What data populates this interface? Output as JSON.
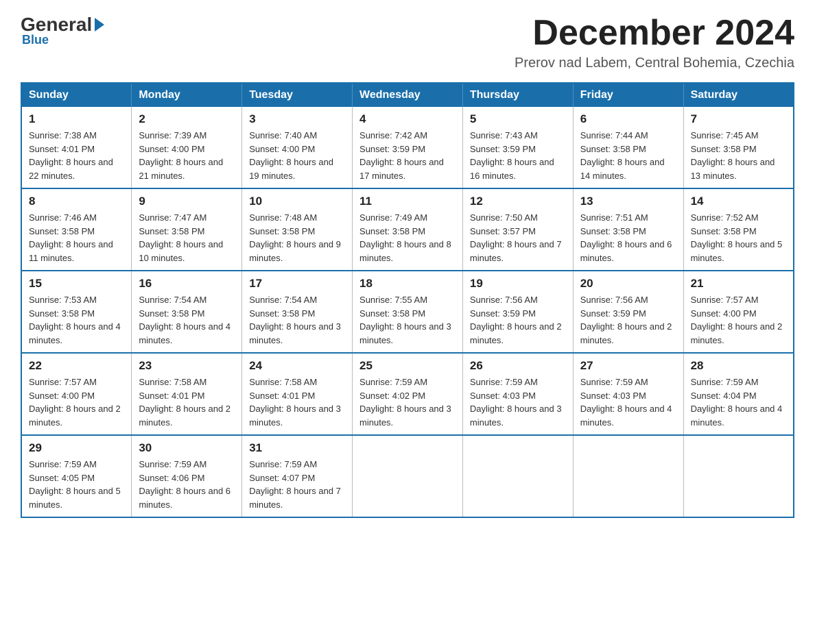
{
  "header": {
    "logo": {
      "general": "General",
      "blue": "Blue"
    },
    "title": "December 2024",
    "location": "Prerov nad Labem, Central Bohemia, Czechia"
  },
  "weekdays": [
    "Sunday",
    "Monday",
    "Tuesday",
    "Wednesday",
    "Thursday",
    "Friday",
    "Saturday"
  ],
  "weeks": [
    [
      {
        "day": "1",
        "sunrise": "7:38 AM",
        "sunset": "4:01 PM",
        "daylight": "8 hours and 22 minutes."
      },
      {
        "day": "2",
        "sunrise": "7:39 AM",
        "sunset": "4:00 PM",
        "daylight": "8 hours and 21 minutes."
      },
      {
        "day": "3",
        "sunrise": "7:40 AM",
        "sunset": "4:00 PM",
        "daylight": "8 hours and 19 minutes."
      },
      {
        "day": "4",
        "sunrise": "7:42 AM",
        "sunset": "3:59 PM",
        "daylight": "8 hours and 17 minutes."
      },
      {
        "day": "5",
        "sunrise": "7:43 AM",
        "sunset": "3:59 PM",
        "daylight": "8 hours and 16 minutes."
      },
      {
        "day": "6",
        "sunrise": "7:44 AM",
        "sunset": "3:58 PM",
        "daylight": "8 hours and 14 minutes."
      },
      {
        "day": "7",
        "sunrise": "7:45 AM",
        "sunset": "3:58 PM",
        "daylight": "8 hours and 13 minutes."
      }
    ],
    [
      {
        "day": "8",
        "sunrise": "7:46 AM",
        "sunset": "3:58 PM",
        "daylight": "8 hours and 11 minutes."
      },
      {
        "day": "9",
        "sunrise": "7:47 AM",
        "sunset": "3:58 PM",
        "daylight": "8 hours and 10 minutes."
      },
      {
        "day": "10",
        "sunrise": "7:48 AM",
        "sunset": "3:58 PM",
        "daylight": "8 hours and 9 minutes."
      },
      {
        "day": "11",
        "sunrise": "7:49 AM",
        "sunset": "3:58 PM",
        "daylight": "8 hours and 8 minutes."
      },
      {
        "day": "12",
        "sunrise": "7:50 AM",
        "sunset": "3:57 PM",
        "daylight": "8 hours and 7 minutes."
      },
      {
        "day": "13",
        "sunrise": "7:51 AM",
        "sunset": "3:58 PM",
        "daylight": "8 hours and 6 minutes."
      },
      {
        "day": "14",
        "sunrise": "7:52 AM",
        "sunset": "3:58 PM",
        "daylight": "8 hours and 5 minutes."
      }
    ],
    [
      {
        "day": "15",
        "sunrise": "7:53 AM",
        "sunset": "3:58 PM",
        "daylight": "8 hours and 4 minutes."
      },
      {
        "day": "16",
        "sunrise": "7:54 AM",
        "sunset": "3:58 PM",
        "daylight": "8 hours and 4 minutes."
      },
      {
        "day": "17",
        "sunrise": "7:54 AM",
        "sunset": "3:58 PM",
        "daylight": "8 hours and 3 minutes."
      },
      {
        "day": "18",
        "sunrise": "7:55 AM",
        "sunset": "3:58 PM",
        "daylight": "8 hours and 3 minutes."
      },
      {
        "day": "19",
        "sunrise": "7:56 AM",
        "sunset": "3:59 PM",
        "daylight": "8 hours and 2 minutes."
      },
      {
        "day": "20",
        "sunrise": "7:56 AM",
        "sunset": "3:59 PM",
        "daylight": "8 hours and 2 minutes."
      },
      {
        "day": "21",
        "sunrise": "7:57 AM",
        "sunset": "4:00 PM",
        "daylight": "8 hours and 2 minutes."
      }
    ],
    [
      {
        "day": "22",
        "sunrise": "7:57 AM",
        "sunset": "4:00 PM",
        "daylight": "8 hours and 2 minutes."
      },
      {
        "day": "23",
        "sunrise": "7:58 AM",
        "sunset": "4:01 PM",
        "daylight": "8 hours and 2 minutes."
      },
      {
        "day": "24",
        "sunrise": "7:58 AM",
        "sunset": "4:01 PM",
        "daylight": "8 hours and 3 minutes."
      },
      {
        "day": "25",
        "sunrise": "7:59 AM",
        "sunset": "4:02 PM",
        "daylight": "8 hours and 3 minutes."
      },
      {
        "day": "26",
        "sunrise": "7:59 AM",
        "sunset": "4:03 PM",
        "daylight": "8 hours and 3 minutes."
      },
      {
        "day": "27",
        "sunrise": "7:59 AM",
        "sunset": "4:03 PM",
        "daylight": "8 hours and 4 minutes."
      },
      {
        "day": "28",
        "sunrise": "7:59 AM",
        "sunset": "4:04 PM",
        "daylight": "8 hours and 4 minutes."
      }
    ],
    [
      {
        "day": "29",
        "sunrise": "7:59 AM",
        "sunset": "4:05 PM",
        "daylight": "8 hours and 5 minutes."
      },
      {
        "day": "30",
        "sunrise": "7:59 AM",
        "sunset": "4:06 PM",
        "daylight": "8 hours and 6 minutes."
      },
      {
        "day": "31",
        "sunrise": "7:59 AM",
        "sunset": "4:07 PM",
        "daylight": "8 hours and 7 minutes."
      },
      null,
      null,
      null,
      null
    ]
  ]
}
